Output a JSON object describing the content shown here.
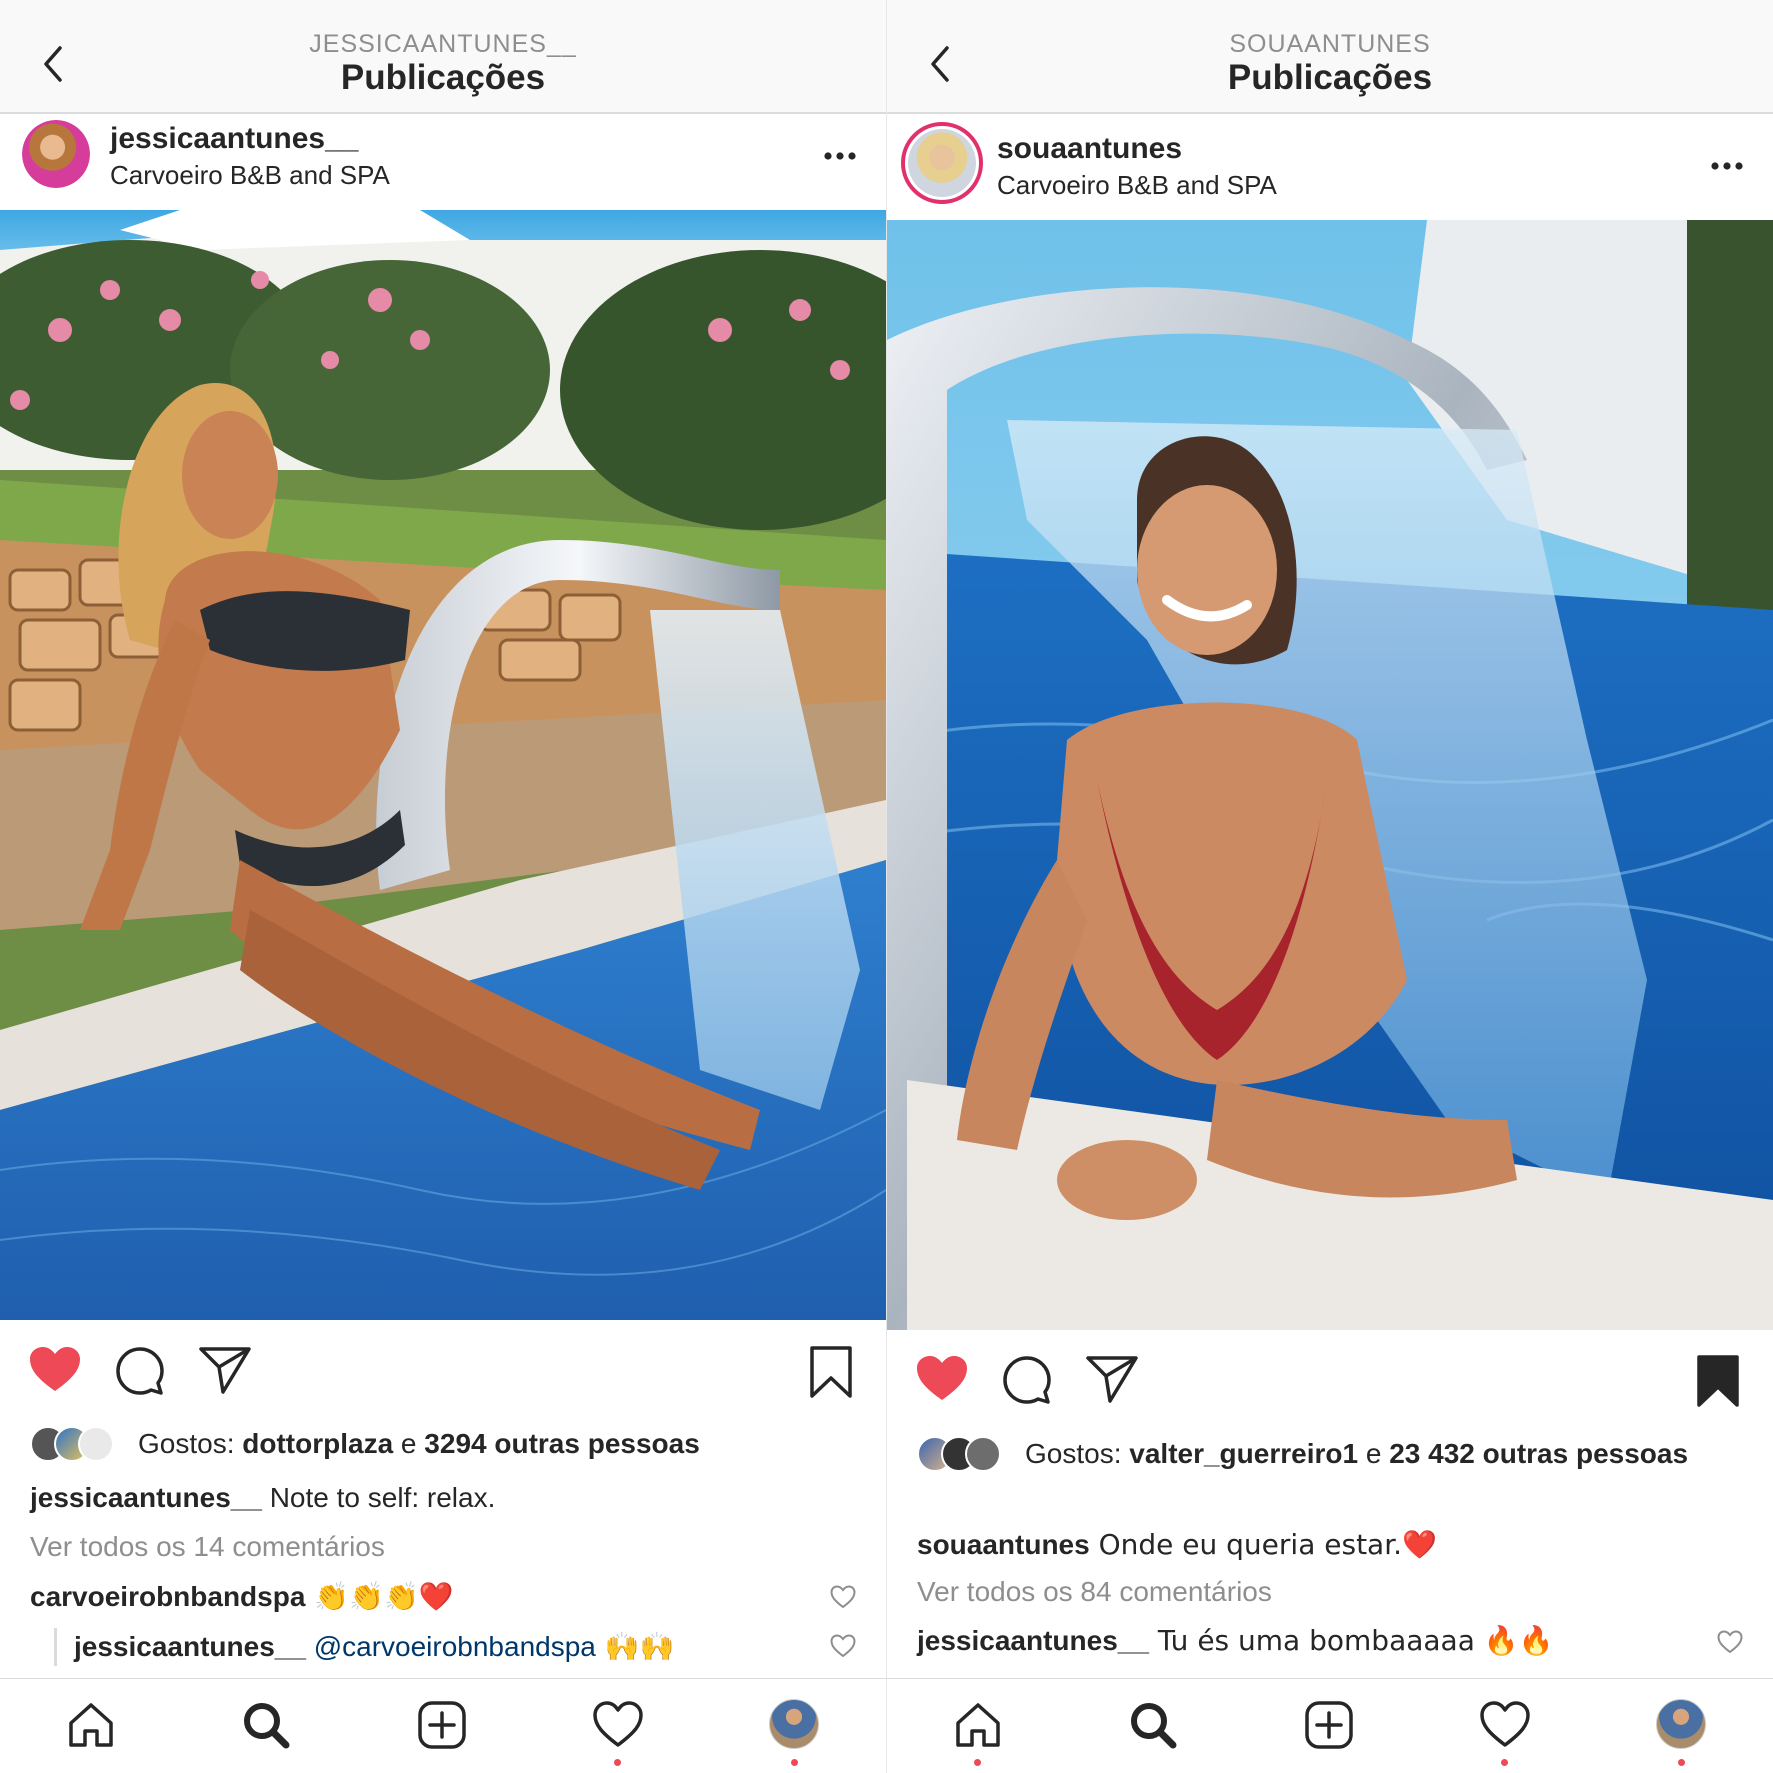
{
  "panels": [
    {
      "header": {
        "eyebrow": "JESSICAANTUNES__",
        "title": "Publicações"
      },
      "post": {
        "username": "jessicaantunes__",
        "location": "Carvoeiro B&B and SPA",
        "liked": true,
        "saved": false,
        "likes_prefix": "Gostos: ",
        "likes_user": "dottorplaza",
        "likes_mid": " e ",
        "likes_rest": "3294 outras pessoas",
        "caption_user": "jessicaantunes__",
        "caption_text": " Note to self: relax.",
        "view_all": "Ver todos os 14 comentários",
        "comments": [
          {
            "user": "carvoeirobnbandspa",
            "text": " 👏👏👏❤️"
          },
          {
            "user": "jessicaantunes__",
            "mention": " @carvoeirobnbandspa",
            "text": " 🙌🙌"
          }
        ]
      }
    },
    {
      "header": {
        "eyebrow": "SOUAANTUNES",
        "title": "Publicações"
      },
      "post": {
        "username": "souaantunes",
        "location": "Carvoeiro B&B and SPA",
        "liked": true,
        "saved": true,
        "likes_prefix": "Gostos: ",
        "likes_user": "valter_guerreiro1",
        "likes_mid": " e ",
        "likes_rest": "23 432 outras pessoas",
        "caption_user": "souaantunes",
        "caption_text": " Onde eu queria estar.❤️",
        "view_all": "Ver todos os 84 comentários",
        "comments": [
          {
            "user": "jessicaantunes__",
            "text": " Tu és uma bombaaaaa 🔥🔥"
          }
        ]
      }
    }
  ],
  "tabbar": {
    "icons": [
      "home-icon",
      "search-icon",
      "new-post-icon",
      "activity-heart-icon",
      "profile-avatar"
    ]
  },
  "colors": {
    "like_red": "#ed4956",
    "text": "#262626",
    "muted": "#8e8e8e",
    "link": "#00376b",
    "story_ring": "#d6249f"
  }
}
